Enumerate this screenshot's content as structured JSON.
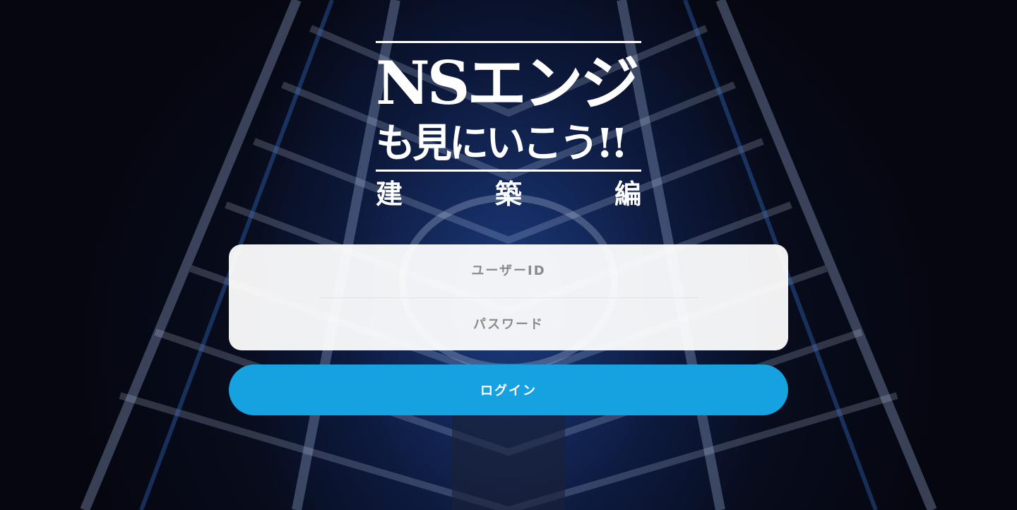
{
  "logo": {
    "line1": "NSエンジ",
    "line2": "も見にいこう!!",
    "line3_chars": [
      "建",
      "築",
      "編"
    ]
  },
  "form": {
    "user_id_placeholder": "ユーザーID",
    "user_id_value": "",
    "password_placeholder": "パスワード",
    "password_value": ""
  },
  "login_button": {
    "label": "ログイン"
  },
  "colors": {
    "accent": "#16a2e0",
    "background": "#05060f",
    "card": "#ffffff"
  }
}
